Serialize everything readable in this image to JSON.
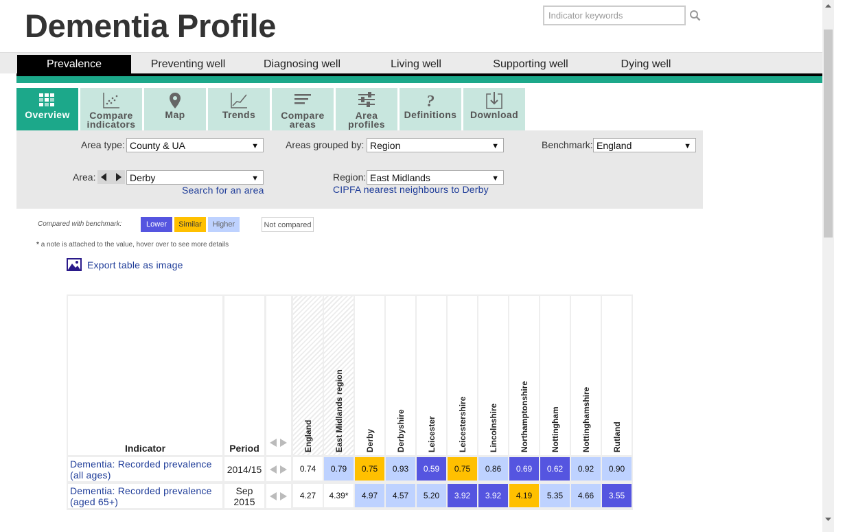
{
  "app": {
    "title": "Dementia Profile"
  },
  "search": {
    "placeholder": "Indicator keywords"
  },
  "main_nav": [
    {
      "label": "Prevalence",
      "active": true
    },
    {
      "label": "Preventing well"
    },
    {
      "label": "Diagnosing well"
    },
    {
      "label": "Living well"
    },
    {
      "label": "Supporting well"
    },
    {
      "label": "Dying well"
    }
  ],
  "tool_tabs": [
    {
      "label": "Overview",
      "icon": "overview-grid-icon",
      "active": true
    },
    {
      "label": "Compare indicators",
      "icon": "scatter-plot-icon"
    },
    {
      "label": "Map",
      "icon": "map-pin-icon"
    },
    {
      "label": "Trends",
      "icon": "line-chart-icon"
    },
    {
      "label": "Compare areas",
      "icon": "bar-lines-icon"
    },
    {
      "label": "Area profiles",
      "icon": "sliders-icon"
    },
    {
      "label": "Definitions",
      "icon": "question-mark-icon"
    },
    {
      "label": "Download",
      "icon": "download-icon"
    }
  ],
  "filters": {
    "area_type_label": "Area type:",
    "area_type_value": "County & UA",
    "grouped_by_label": "Areas grouped by:",
    "grouped_by_value": "Region",
    "benchmark_label": "Benchmark:",
    "benchmark_value": "England",
    "area_label": "Area:",
    "area_value": "Derby",
    "search_area_link": "Search for an area",
    "region_label": "Region:",
    "region_value": "East Midlands",
    "cipfa_link": "CIPFA nearest neighbours to Derby"
  },
  "legend": {
    "label": "Compared with benchmark:",
    "lower": "Lower",
    "similar": "Similar",
    "higher": "Higher",
    "not_compared": "Not compared",
    "note": "a note is attached to the value, hover over to see more details",
    "note_marker": "*",
    "colors": {
      "lower": "#5555e0",
      "similar": "#ffc000",
      "higher": "#bed2ff",
      "not_compared": "#ffffff"
    }
  },
  "export": {
    "label": "Export table as image"
  },
  "table": {
    "indicator_header": "Indicator",
    "period_header": "Period",
    "columns": [
      "England",
      "East Midlands region",
      "Derby",
      "Derbyshire",
      "Leicester",
      "Leicestershire",
      "Lincolnshire",
      "Northamptonshire",
      "Nottingham",
      "Nottinghamshire",
      "Rutland"
    ],
    "rows": [
      {
        "indicator": [
          "Dementia: Recorded prevalence",
          "(all ages)"
        ],
        "period": [
          "2014/15"
        ],
        "values": [
          "0.74",
          "0.79",
          "0.75",
          "0.93",
          "0.59",
          "0.75",
          "0.86",
          "0.69",
          "0.62",
          "0.92",
          "0.90"
        ],
        "status": [
          "none",
          "higher",
          "similar",
          "higher",
          "lower",
          "similar",
          "higher",
          "lower",
          "lower",
          "higher",
          "higher"
        ]
      },
      {
        "indicator": [
          "Dementia: Recorded prevalence",
          "(aged 65+)"
        ],
        "period": [
          "Sep",
          "2015"
        ],
        "values": [
          "4.27",
          "4.39*",
          "4.97",
          "4.57",
          "5.20",
          "3.92",
          "3.92",
          "4.19",
          "5.35",
          "4.66",
          "3.55"
        ],
        "status": [
          "none",
          "none",
          "higher",
          "higher",
          "higher",
          "lower",
          "lower",
          "similar",
          "higher",
          "higher",
          "lower"
        ]
      }
    ]
  }
}
